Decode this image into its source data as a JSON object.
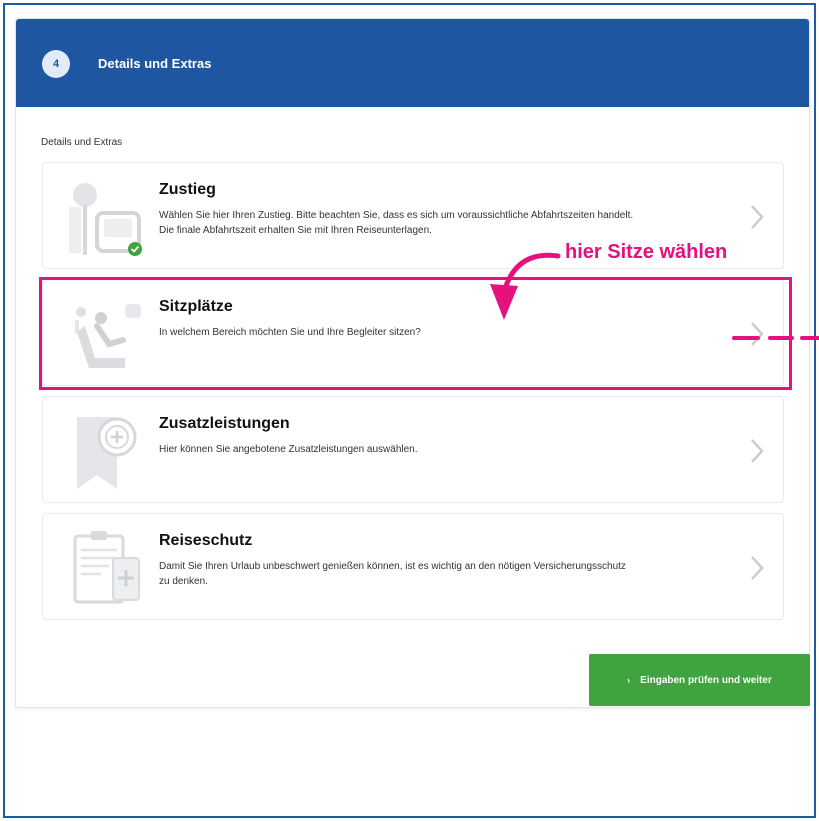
{
  "header": {
    "step_number": "4",
    "title": "Details und Extras"
  },
  "section_label": "Details und Extras",
  "cards": [
    {
      "title": "Zustieg",
      "description": "Wählen Sie hier Ihren Zustieg. Bitte beachten Sie, dass es sich um voraussichtliche Abfahrtszeiten handelt.\nDie finale Abfahrtszeit erhalten Sie mit Ihren Reiseunterlagen.",
      "icon": "bus-stop-icon"
    },
    {
      "title": "Sitzplätze",
      "description": "In welchem Bereich möchten Sie und Ihre Begleiter sitzen?",
      "icon": "seat-icon"
    },
    {
      "title": "Zusatzleistungen",
      "description": "Hier können Sie angebotene Zusatzleistungen auswählen.",
      "icon": "ribbon-plus-icon"
    },
    {
      "title": "Reiseschutz",
      "description": "Damit Sie Ihren Urlaub unbeschwert genießen können, ist es wichtig an den nötigen Versicherungsschutz\nzu denken.",
      "icon": "insurance-document-icon"
    }
  ],
  "next_button": {
    "label": "Eingaben prüfen und weiter",
    "arrow": "›"
  },
  "annotation": {
    "text": "hier Sitze wählen",
    "color": "#e5127d"
  },
  "colors": {
    "header_blue": "#1f56a2",
    "button_green": "#3fa33f",
    "checkmark_green": "#3fa33f",
    "highlight_pink": "#e5127d"
  }
}
